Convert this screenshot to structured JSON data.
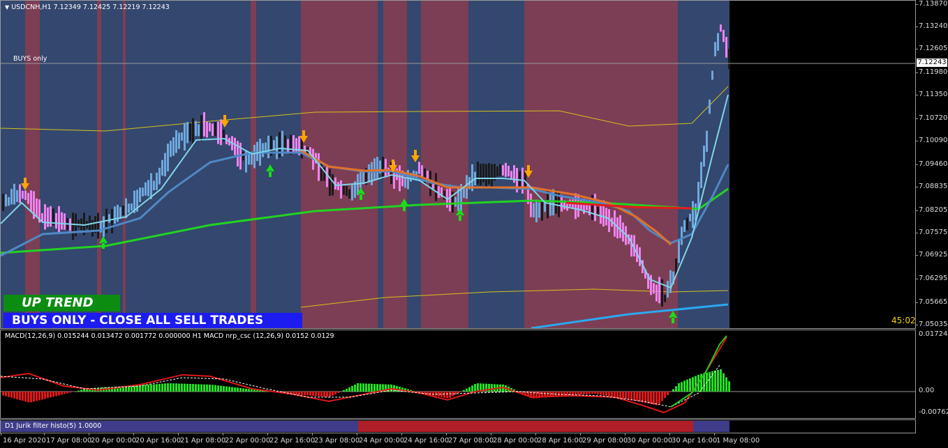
{
  "symbol_header": {
    "menu_arrow": "triangle-down-icon",
    "text": "USDCNH,H1  7.12349 7.12425 7.12219 7.12243"
  },
  "main_chart": {
    "hline_label": "BUYS only",
    "current_price": "7.12243",
    "countdown": "45:02",
    "up_trend_label": "UP TREND",
    "buys_only_label": "BUYS ONLY - CLOSE ALL SELL TRADES",
    "price_ticks": [
      "7.13870",
      "7.13240",
      "7.12605",
      "7.11980",
      "7.11350",
      "7.10720",
      "7.10090",
      "7.09460",
      "7.08835",
      "7.08205",
      "7.07575",
      "7.06925",
      "7.06295",
      "7.05665",
      "7.05035"
    ],
    "colors": {
      "bg_blue": "#34476e",
      "bg_red": "#7c3e54",
      "up_bar": "#6fa8dc",
      "down_bar": "#ee82ee",
      "neutral_bar": "#1a1a1a",
      "green_ma": "#22d322",
      "orange_ma": "#e0722a",
      "yellow_band": "#d6c21c",
      "arrow_up": "#16e016",
      "arrow_down": "#ffa500"
    }
  },
  "macd_pane": {
    "label": "MACD(12,26,9) 0.015244 0.013472 0.001772 0.000000  H1 MACD nrp_csc (12,26,9) 0.0152 0.0129",
    "ticks": [
      "0.017248",
      "0.00",
      "-0.007622"
    ]
  },
  "jurik_pane": {
    "label": "D1 Jurik filter histo(5) 1.0000",
    "colors": {
      "blue": "#3f3d8a",
      "red": "#b01f28"
    }
  },
  "time_axis": [
    "16 Apr 2020",
    "17 Apr 08:00",
    "20 Apr 00:00",
    "20 Apr 16:00",
    "21 Apr 08:00",
    "22 Apr 00:00",
    "22 Apr 16:00",
    "23 Apr 08:00",
    "24 Apr 00:00",
    "24 Apr 16:00",
    "27 Apr 08:00",
    "28 Apr 00:00",
    "28 Apr 16:00",
    "29 Apr 08:00",
    "30 Apr 00:00",
    "30 Apr 16:00",
    "1 May 08:00"
  ]
}
